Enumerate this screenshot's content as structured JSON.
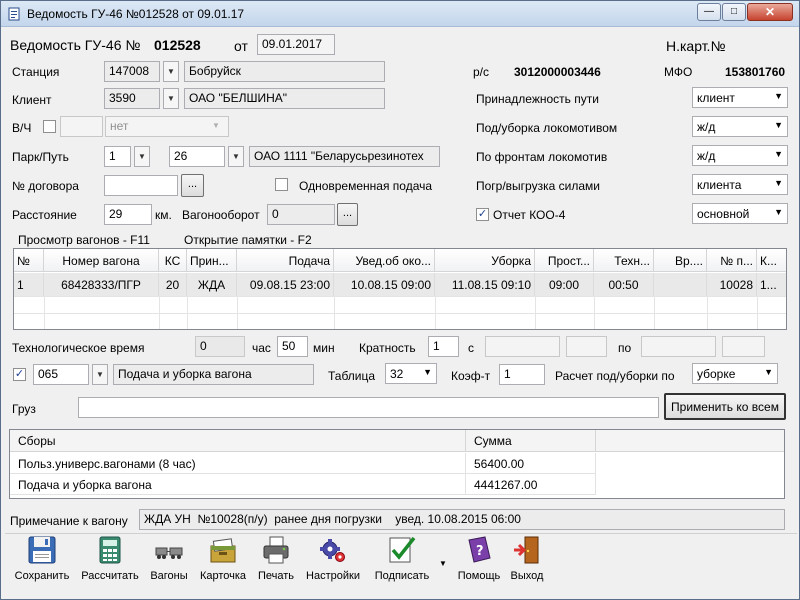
{
  "window": {
    "title": "Ведомость ГУ-46 №012528 от 09.01.17",
    "min": "—",
    "max": "□",
    "close": "✕"
  },
  "header": {
    "label": "Ведомость ГУ-46 №",
    "number": "012528",
    "date_label": "от",
    "date": "09.01.2017",
    "card_label": "Н.карт.№"
  },
  "station": {
    "label": "Станция",
    "code": "147008",
    "name": "Бобруйск"
  },
  "client": {
    "label": "Клиент",
    "code": "3590",
    "name": "ОАО \"БЕЛШИНА\""
  },
  "vch": {
    "label": "В/Ч",
    "value": "нет"
  },
  "park": {
    "label": "Парк/Путь",
    "park": "1",
    "path": "26",
    "owner": "ОАО 1111 \"Беларусьрезинотех"
  },
  "contract": {
    "label": "№ договора",
    "btn": "..."
  },
  "simultaneous": {
    "label": "Одновременная подача"
  },
  "distance": {
    "label": "Расстояние",
    "value": "29",
    "unit": "км."
  },
  "turnover": {
    "label": "Вагонооборот",
    "value": "0",
    "btn": "..."
  },
  "bank": {
    "rs_label": "р/с",
    "rs": "3012000003446",
    "mfo_label": "МФО",
    "mfo": "153801760"
  },
  "right_form": [
    {
      "label": "Принадлежность пути",
      "value": "клиент"
    },
    {
      "label": "Под/уборка локомотивом",
      "value": "ж/д"
    },
    {
      "label": "По фронтам локомотив",
      "value": "ж/д"
    },
    {
      "label": "Погр/выгрузка силами",
      "value": "клиента"
    }
  ],
  "koo": {
    "label": "Отчет КОО-4",
    "value": "основной"
  },
  "links": {
    "view": "Просмотр вагонов - F11",
    "memo": "Открытие памятки - F2"
  },
  "grid": {
    "columns": [
      "№",
      "Номер вагона",
      "КС",
      "Прин...",
      "Подача",
      "Увед.об око...",
      "Уборка",
      "Прост...",
      "Техн...",
      "Вр....",
      "№ п...",
      "К..."
    ],
    "rows": [
      [
        "1",
        "68428333/ПГР",
        "20",
        "ЖДА",
        "09.08.15 23:00",
        "10.08.15 09:00",
        "11.08.15 09:10",
        "09:00",
        "00:50",
        "",
        "10028",
        "1..."
      ]
    ]
  },
  "tech_time": {
    "label": "Технологическое время",
    "hours": "0",
    "hours_unit": "час",
    "minutes": "50",
    "minutes_unit": "мин"
  },
  "multiplicity": {
    "label": "Кратность",
    "value": "1",
    "from_label": "с",
    "to_label": "по"
  },
  "service": {
    "code": "065",
    "name": "Подача и уборка вагона"
  },
  "table": {
    "label": "Таблица",
    "value": "32"
  },
  "coef": {
    "label": "Коэф-т",
    "value": "1"
  },
  "calc": {
    "label": "Расчет под/уборки по",
    "value": "уборке"
  },
  "cargo": {
    "label": "Груз",
    "apply": "Применить ко всем"
  },
  "fees": {
    "headers": [
      "Сборы",
      "Сумма"
    ],
    "rows": [
      [
        "Польз.универс.вагонами (8 час)",
        "56400.00"
      ],
      [
        "Подача и уборка вагона",
        "4441267.00"
      ]
    ]
  },
  "note": {
    "label": "Примечание к вагону",
    "text": "ЖДА УН  №10028(п/у)  ранее дня погрузки    увед. 10.08.2015 06:00"
  },
  "toolbar": {
    "save": "Сохранить",
    "calc": "Рассчитать",
    "wagons": "Вагоны",
    "card": "Карточка",
    "print": "Печать",
    "settings": "Настройки",
    "sign": "Подписать",
    "help": "Помощь",
    "exit": "Выход"
  },
  "colors": {
    "accent": "#1d3f91",
    "title_bar": "#c4d6ec",
    "close": "#c7432f"
  }
}
